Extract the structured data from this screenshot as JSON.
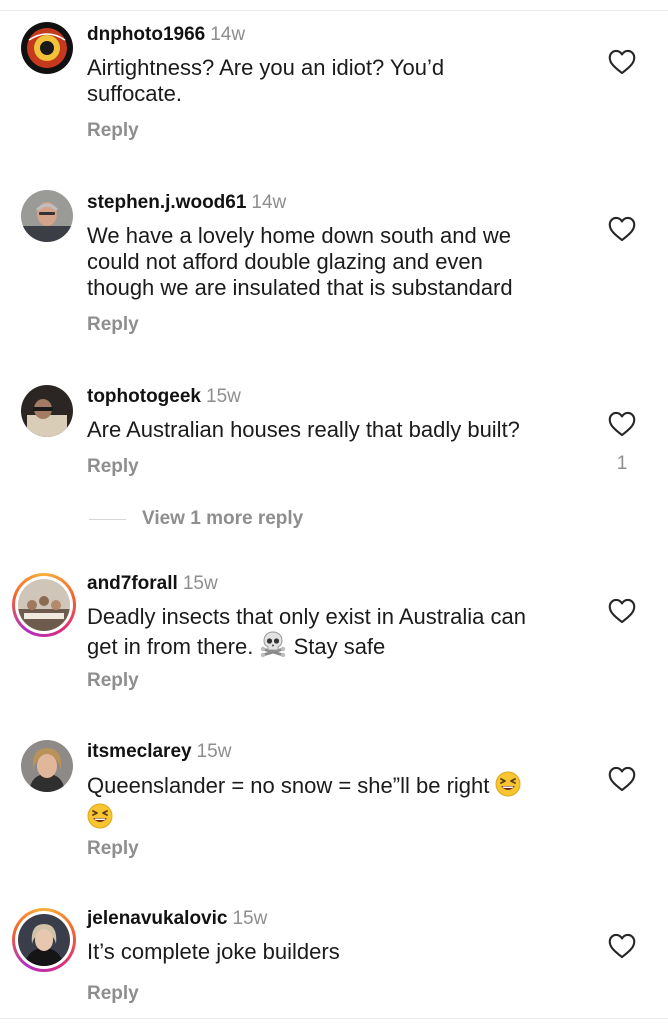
{
  "comments": [
    {
      "username": "dnphoto1966",
      "time": "14w",
      "lines": [
        "Airtightness? Are you an idiot? You’d",
        "suffocate."
      ],
      "reply_label": "Reply",
      "likes": ""
    },
    {
      "username": "stephen.j.wood61",
      "time": "14w",
      "lines": [
        "We have a lovely home down south and we",
        "could not afford double glazing and even",
        "though we are insulated that is substandard"
      ],
      "reply_label": "Reply",
      "likes": ""
    },
    {
      "username": "tophotogeek",
      "time": "15w",
      "lines": [
        "Are Australian houses really that badly built?"
      ],
      "reply_label": "Reply",
      "likes": "1",
      "view_more": "View 1 more reply"
    },
    {
      "username": "and7forall",
      "time": "15w",
      "lines": [
        "Deadly insects that only exist in Australia can",
        "get in from there.",
        "Stay safe"
      ],
      "emoji": "skull-and-crossbones",
      "reply_label": "Reply",
      "likes": ""
    },
    {
      "username": "itsmeclarey",
      "time": "15w",
      "lines": [
        "Queenslander = no snow = she”ll be right"
      ],
      "emoji": "grinning-squinting-face",
      "reply_label": "Reply",
      "likes": ""
    },
    {
      "username": "jelenavukalovic",
      "time": "15w",
      "lines": [
        "It’s complete joke builders"
      ],
      "reply_label": "Reply",
      "likes": ""
    }
  ],
  "colors": {
    "secondary_text": "#8e8e8e",
    "primary_text": "#121212",
    "story_ring": [
      "#f9b23a",
      "#d92e7c",
      "#b12ec7"
    ]
  },
  "icons": {
    "like": "heart-outline-icon",
    "emoji_skull": "skull-and-crossbones-icon",
    "emoji_laugh": "grinning-squinting-face-icon"
  }
}
